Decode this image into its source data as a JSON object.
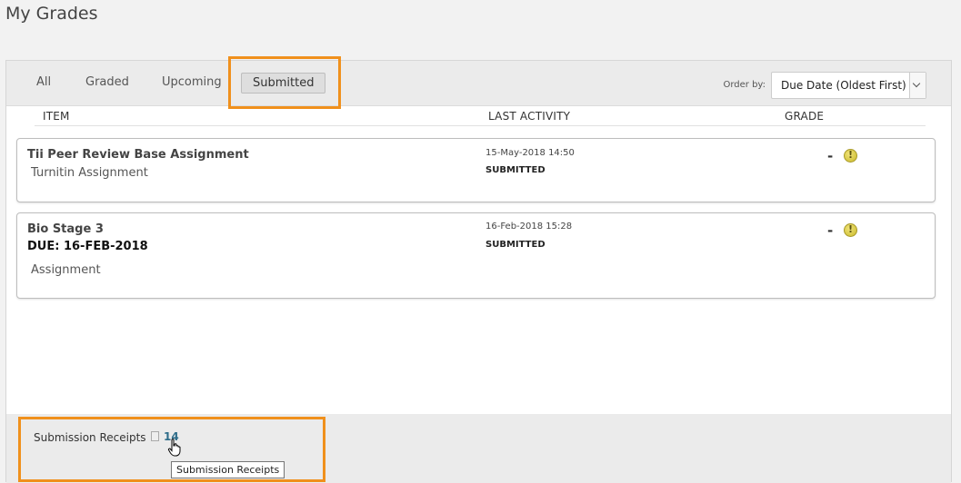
{
  "page": {
    "title": "My Grades"
  },
  "tabs": [
    {
      "label": "All",
      "active": false
    },
    {
      "label": "Graded",
      "active": false
    },
    {
      "label": "Upcoming",
      "active": false
    },
    {
      "label": "Submitted",
      "active": true
    }
  ],
  "order_by": {
    "label": "Order by:",
    "selected": "Due Date (Oldest First)"
  },
  "columns": {
    "item": "ITEM",
    "last_activity": "LAST ACTIVITY",
    "grade": "GRADE"
  },
  "items": [
    {
      "name": "Tii Peer Review Base Assignment",
      "type": "Turnitin Assignment",
      "date": "15-May-2018 14:50",
      "status": "SUBMITTED",
      "grade": "-",
      "grade_icon": "exclamation-circle-icon"
    },
    {
      "name": "Bio Stage 3",
      "due": "DUE: 16-FEB-2018",
      "type": "Assignment",
      "date": "16-Feb-2018 15:28",
      "status": "SUBMITTED",
      "grade": "-",
      "grade_icon": "exclamation-circle-icon"
    }
  ],
  "footer": {
    "receipts_label": "Submission Receipts",
    "receipts_count": "14",
    "tooltip": "Submission Receipts"
  },
  "colors": {
    "highlight": "#f0901c",
    "link": "#2f6d8a",
    "warning": "#d4c43a"
  }
}
